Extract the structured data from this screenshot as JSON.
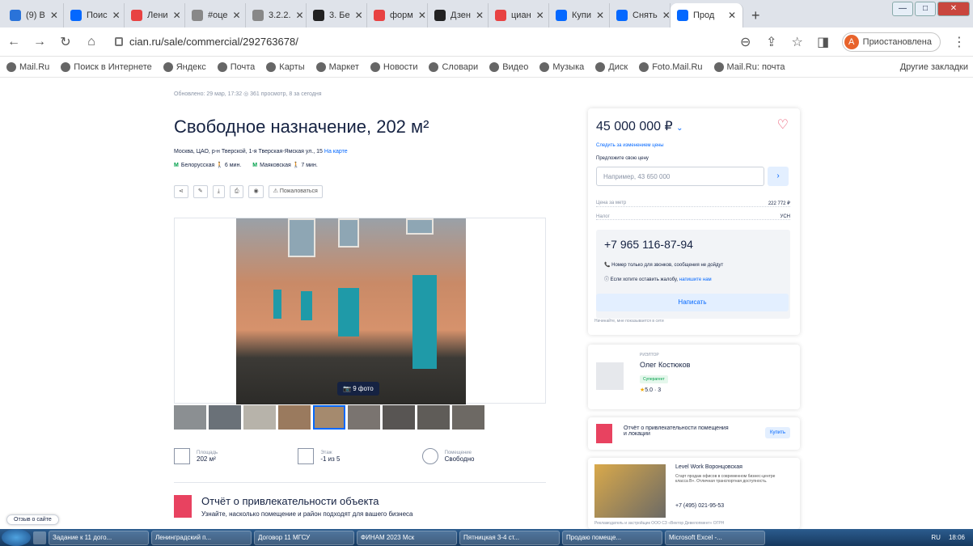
{
  "browser": {
    "tabs": [
      {
        "label": "(9) В",
        "color": "#2a73d9"
      },
      {
        "label": "Поис",
        "color": "#0468ff"
      },
      {
        "label": "Лени",
        "color": "#e84242"
      },
      {
        "label": "#оце",
        "color": "#888888"
      },
      {
        "label": "3.2.2.",
        "color": "#888888"
      },
      {
        "label": "3. Бе",
        "color": "#222222"
      },
      {
        "label": "форм",
        "color": "#e84242"
      },
      {
        "label": "Дзен",
        "color": "#222222"
      },
      {
        "label": "циан",
        "color": "#e84242"
      },
      {
        "label": "Купи",
        "color": "#0468ff"
      },
      {
        "label": "Снять",
        "color": "#0468ff"
      },
      {
        "label": "Прод",
        "color": "#0468ff"
      }
    ],
    "url": "cian.ru/sale/commercial/292763678/",
    "profile_initial": "A",
    "profile_status": "Приостановлена",
    "bookmarks": [
      "Mail.Ru",
      "Поиск в Интернете",
      "Яндекс",
      "Почта",
      "Карты",
      "Маркет",
      "Новости",
      "Словари",
      "Видео",
      "Музыка",
      "Диск",
      "Foto.Mail.Ru",
      "Mail.Ru: почта"
    ],
    "bookmarks_more": "Другие закладки"
  },
  "listing": {
    "meta": "Обновлено: 29 мар, 17:32   ◎ 361 просмотр, 8 за сегодня",
    "title": "Свободное назначение, 202 м²",
    "address": "Москва, ЦАО, р-н Тверской, 1-я Тверская-Ямская ул., 15",
    "address_map": "На карте",
    "metro": [
      {
        "name": "Белорусская",
        "time": "6 мин."
      },
      {
        "name": "Маяковская",
        "time": "7 мин."
      }
    ],
    "complain": "Пожаловаться",
    "photos_badge": "9 фото",
    "facts": [
      {
        "label": "Площадь",
        "value": "202 м²"
      },
      {
        "label": "Этаж",
        "value": "-1 из 5"
      },
      {
        "label": "Помещение",
        "value": "Свободно"
      }
    ],
    "report_title": "Отчёт о привлекательности объекта",
    "report_sub": "Узнайте, насколько помещение и район подходят для вашего бизнеса"
  },
  "card": {
    "price": "45 000 000 ₽",
    "follow": "Следить за изменением цены",
    "offer_label": "Предложите свою цену",
    "offer_placeholder": "Например, 43 650 000",
    "price_per_m_label": "Цена за метр",
    "price_per_m": "222 772 ₽",
    "tax_label": "Налог",
    "tax": "УСН",
    "phone": "+7 965 116-87-94",
    "note1": "Номер только для звонков, сообщения не дойдут",
    "note2": "Если хотите оставить жалобу,",
    "note2_link": "напишите нам",
    "write_btn": "Написать",
    "card_note": "Начинайте, мне показывается в сети"
  },
  "realtor": {
    "role": "РИЭЛТОР",
    "name": "Олег Костюков",
    "badge": "Суперагент",
    "rating": "5.0 · 3"
  },
  "attract": {
    "title": "Отчёт о привлекательности помещения и локации",
    "button": "Купить"
  },
  "ad": {
    "name": "Level Work Воронцовская",
    "desc": "Старт продаж офисов в современном бизнес-центре класса В+. Отличная транспортная доступность.",
    "phone": "+7 (495) 021-95-53",
    "footer": "Рекламодатель и застройщик ООО СЗ «Вектор Девелопмент» ОГРН"
  },
  "feedback": "Отзыв о сайте",
  "taskbar": {
    "items": [
      "Задание к 11 дого...",
      "Ленинградский п...",
      "Договор 11 МГСУ",
      "ФИНАМ 2023 Мск",
      "Пятницкая 3-4 ст...",
      "Продаю помеще...",
      "Microsoft Excel -..."
    ],
    "lang": "RU",
    "time": "18:06"
  }
}
